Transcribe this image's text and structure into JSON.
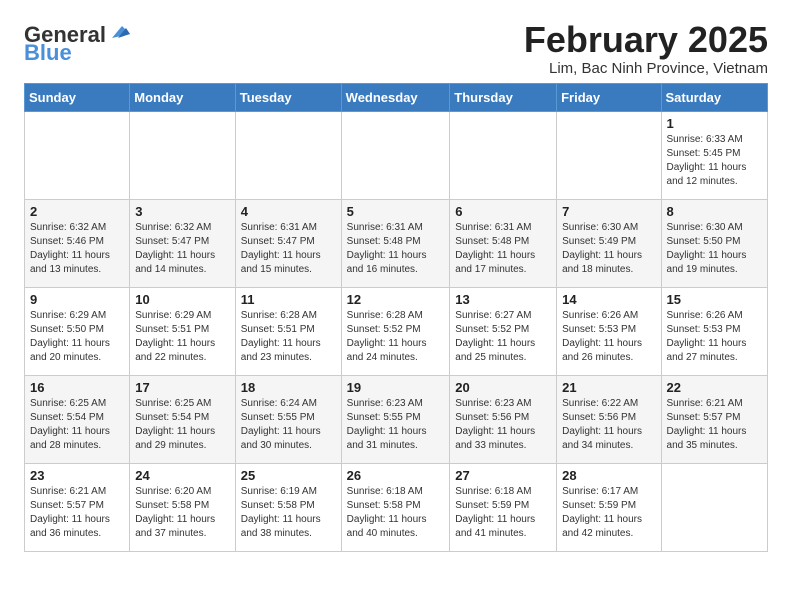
{
  "logo": {
    "general": "General",
    "blue": "Blue"
  },
  "title": {
    "month": "February 2025",
    "location": "Lim, Bac Ninh Province, Vietnam"
  },
  "weekdays": [
    "Sunday",
    "Monday",
    "Tuesday",
    "Wednesday",
    "Thursday",
    "Friday",
    "Saturday"
  ],
  "weeks": [
    [
      {
        "day": "",
        "info": ""
      },
      {
        "day": "",
        "info": ""
      },
      {
        "day": "",
        "info": ""
      },
      {
        "day": "",
        "info": ""
      },
      {
        "day": "",
        "info": ""
      },
      {
        "day": "",
        "info": ""
      },
      {
        "day": "1",
        "info": "Sunrise: 6:33 AM\nSunset: 5:45 PM\nDaylight: 11 hours and 12 minutes."
      }
    ],
    [
      {
        "day": "2",
        "info": "Sunrise: 6:32 AM\nSunset: 5:46 PM\nDaylight: 11 hours and 13 minutes."
      },
      {
        "day": "3",
        "info": "Sunrise: 6:32 AM\nSunset: 5:47 PM\nDaylight: 11 hours and 14 minutes."
      },
      {
        "day": "4",
        "info": "Sunrise: 6:31 AM\nSunset: 5:47 PM\nDaylight: 11 hours and 15 minutes."
      },
      {
        "day": "5",
        "info": "Sunrise: 6:31 AM\nSunset: 5:48 PM\nDaylight: 11 hours and 16 minutes."
      },
      {
        "day": "6",
        "info": "Sunrise: 6:31 AM\nSunset: 5:48 PM\nDaylight: 11 hours and 17 minutes."
      },
      {
        "day": "7",
        "info": "Sunrise: 6:30 AM\nSunset: 5:49 PM\nDaylight: 11 hours and 18 minutes."
      },
      {
        "day": "8",
        "info": "Sunrise: 6:30 AM\nSunset: 5:50 PM\nDaylight: 11 hours and 19 minutes."
      }
    ],
    [
      {
        "day": "9",
        "info": "Sunrise: 6:29 AM\nSunset: 5:50 PM\nDaylight: 11 hours and 20 minutes."
      },
      {
        "day": "10",
        "info": "Sunrise: 6:29 AM\nSunset: 5:51 PM\nDaylight: 11 hours and 22 minutes."
      },
      {
        "day": "11",
        "info": "Sunrise: 6:28 AM\nSunset: 5:51 PM\nDaylight: 11 hours and 23 minutes."
      },
      {
        "day": "12",
        "info": "Sunrise: 6:28 AM\nSunset: 5:52 PM\nDaylight: 11 hours and 24 minutes."
      },
      {
        "day": "13",
        "info": "Sunrise: 6:27 AM\nSunset: 5:52 PM\nDaylight: 11 hours and 25 minutes."
      },
      {
        "day": "14",
        "info": "Sunrise: 6:26 AM\nSunset: 5:53 PM\nDaylight: 11 hours and 26 minutes."
      },
      {
        "day": "15",
        "info": "Sunrise: 6:26 AM\nSunset: 5:53 PM\nDaylight: 11 hours and 27 minutes."
      }
    ],
    [
      {
        "day": "16",
        "info": "Sunrise: 6:25 AM\nSunset: 5:54 PM\nDaylight: 11 hours and 28 minutes."
      },
      {
        "day": "17",
        "info": "Sunrise: 6:25 AM\nSunset: 5:54 PM\nDaylight: 11 hours and 29 minutes."
      },
      {
        "day": "18",
        "info": "Sunrise: 6:24 AM\nSunset: 5:55 PM\nDaylight: 11 hours and 30 minutes."
      },
      {
        "day": "19",
        "info": "Sunrise: 6:23 AM\nSunset: 5:55 PM\nDaylight: 11 hours and 31 minutes."
      },
      {
        "day": "20",
        "info": "Sunrise: 6:23 AM\nSunset: 5:56 PM\nDaylight: 11 hours and 33 minutes."
      },
      {
        "day": "21",
        "info": "Sunrise: 6:22 AM\nSunset: 5:56 PM\nDaylight: 11 hours and 34 minutes."
      },
      {
        "day": "22",
        "info": "Sunrise: 6:21 AM\nSunset: 5:57 PM\nDaylight: 11 hours and 35 minutes."
      }
    ],
    [
      {
        "day": "23",
        "info": "Sunrise: 6:21 AM\nSunset: 5:57 PM\nDaylight: 11 hours and 36 minutes."
      },
      {
        "day": "24",
        "info": "Sunrise: 6:20 AM\nSunset: 5:58 PM\nDaylight: 11 hours and 37 minutes."
      },
      {
        "day": "25",
        "info": "Sunrise: 6:19 AM\nSunset: 5:58 PM\nDaylight: 11 hours and 38 minutes."
      },
      {
        "day": "26",
        "info": "Sunrise: 6:18 AM\nSunset: 5:58 PM\nDaylight: 11 hours and 40 minutes."
      },
      {
        "day": "27",
        "info": "Sunrise: 6:18 AM\nSunset: 5:59 PM\nDaylight: 11 hours and 41 minutes."
      },
      {
        "day": "28",
        "info": "Sunrise: 6:17 AM\nSunset: 5:59 PM\nDaylight: 11 hours and 42 minutes."
      },
      {
        "day": "",
        "info": ""
      }
    ]
  ]
}
